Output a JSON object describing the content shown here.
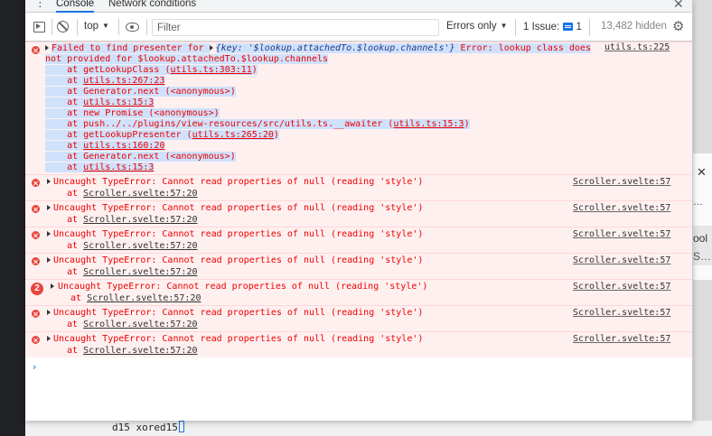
{
  "tabs": [
    {
      "label": "Console",
      "active": true
    },
    {
      "label": "Network conditions",
      "active": false
    }
  ],
  "toolbar": {
    "context": "top",
    "filter_placeholder": "Filter",
    "levels": "Errors only",
    "issues_label": "1 Issue:",
    "issues_count": "1",
    "hidden": "13,482 hidden"
  },
  "first_error": {
    "prefix": "Failed to find presenter for ",
    "object": "{key: '$lookup.attachedTo.$lookup.channels'}",
    "message": " Error: lookup class does",
    "message2": "not provided for $lookup.attachedTo.$lookup.channels",
    "source": "utils.ts:225",
    "stack": [
      {
        "text": "    at getLookupClass (",
        "link": "utils.ts:303:11",
        "tail": ")"
      },
      {
        "text": "    at ",
        "link": "utils.ts:267:23",
        "tail": ""
      },
      {
        "text": "    at Generator.next (<anonymous>)",
        "link": "",
        "tail": ""
      },
      {
        "text": "    at ",
        "link": "utils.ts:15:3",
        "tail": ""
      },
      {
        "text": "    at new Promise (<anonymous>)",
        "link": "",
        "tail": ""
      },
      {
        "text": "    at push../../plugins/view-resources/src/utils.ts.__awaiter (",
        "link": "utils.ts:15:3",
        "tail": ")"
      },
      {
        "text": "    at getLookupPresenter (",
        "link": "utils.ts:265:20",
        "tail": ")"
      },
      {
        "text": "    at ",
        "link": "utils.ts:160:20",
        "tail": ""
      },
      {
        "text": "    at Generator.next (<anonymous>)",
        "link": "",
        "tail": ""
      },
      {
        "text": "    at ",
        "link": "utils.ts:15:3",
        "tail": ""
      }
    ]
  },
  "errors": [
    {
      "message": "Uncaught TypeError: Cannot read properties of null (reading 'style')",
      "at": "at ",
      "location": "Scroller.svelte:57:20",
      "source": "Scroller.svelte:57",
      "count": ""
    },
    {
      "message": "Uncaught TypeError: Cannot read properties of null (reading 'style')",
      "at": "at ",
      "location": "Scroller.svelte:57:20",
      "source": "Scroller.svelte:57",
      "count": ""
    },
    {
      "message": "Uncaught TypeError: Cannot read properties of null (reading 'style')",
      "at": "at ",
      "location": "Scroller.svelte:57:20",
      "source": "Scroller.svelte:57",
      "count": ""
    },
    {
      "message": "Uncaught TypeError: Cannot read properties of null (reading 'style')",
      "at": "at ",
      "location": "Scroller.svelte:57:20",
      "source": "Scroller.svelte:57",
      "count": ""
    },
    {
      "message": "Uncaught TypeError: Cannot read properties of null (reading 'style')",
      "at": "at ",
      "location": "Scroller.svelte:57:20",
      "source": "Scroller.svelte:57",
      "count": "2"
    },
    {
      "message": "Uncaught TypeError: Cannot read properties of null (reading 'style')",
      "at": "at ",
      "location": "Scroller.svelte:57:20",
      "source": "Scroller.svelte:57",
      "count": ""
    },
    {
      "message": "Uncaught TypeError: Cannot read properties of null (reading 'style')",
      "at": "at ",
      "location": "Scroller.svelte:57:20",
      "source": "Scroller.svelte:57",
      "count": ""
    }
  ],
  "prompt": "›",
  "background": {
    "right_text_1": "ool",
    "right_text_2": "S…",
    "right_dots": "…",
    "editor_text": "d15 xored15"
  }
}
